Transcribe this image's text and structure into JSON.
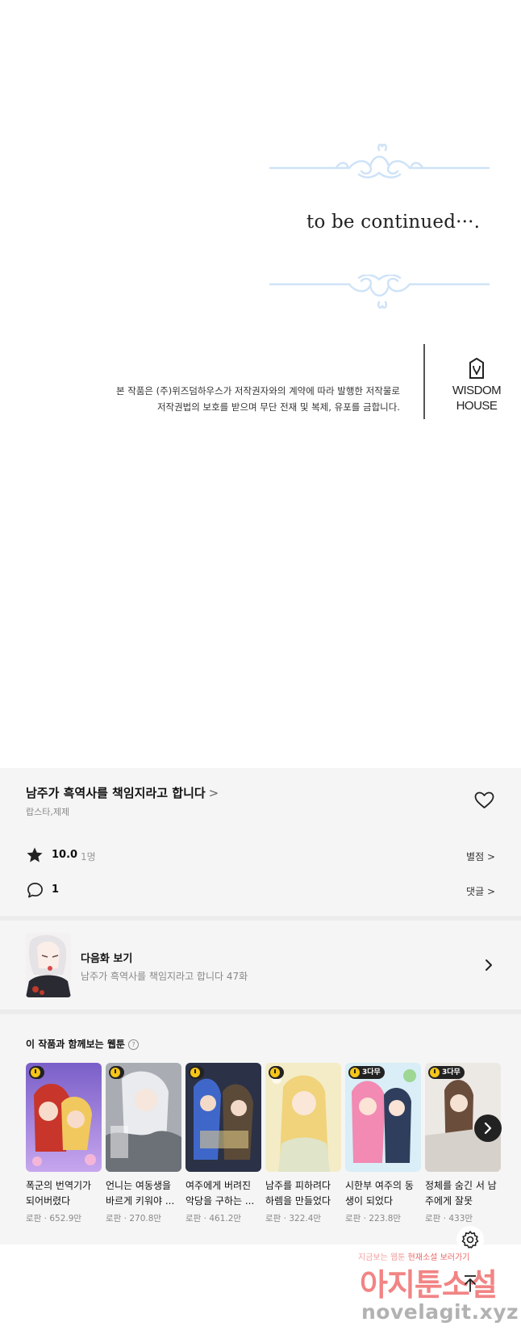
{
  "ending": {
    "tbc": "to be continued···.",
    "copyright_line1": "본 작품은 (주)위즈덤하우스가 저작권자와의 계약에 따라 발행한 저작물로",
    "copyright_line2": "저작권법의 보호를 받으며 무단 전재 및 복제, 유포를 금합니다.",
    "publisher_line1": "WISDOM",
    "publisher_line2": "HOUSE"
  },
  "series": {
    "title": "남주가 흑역사를 책임지라고 합니다",
    "title_chevron": ">",
    "authors": "랍스타,제제",
    "rating_score": "10.0",
    "rating_count": "1명",
    "rating_link": "별점 >",
    "comment_count": "1",
    "comment_link": "댓글 >"
  },
  "next_episode": {
    "label": "다음화 보기",
    "subtitle": "남주가 흑역사를 책임지라고 합니다 47화"
  },
  "recommend": {
    "heading": "이 작품과 함께보는 웹툰",
    "help": "?",
    "items": [
      {
        "title": "폭군의 번역기가 되어버렸다",
        "meta": "로판 · 652.9만",
        "badge": ""
      },
      {
        "title": "언니는 여동생을 바르게 키워야 ...",
        "meta": "로판 · 270.8만",
        "badge": ""
      },
      {
        "title": "여주에게 버려진 악당을 구하는 ...",
        "meta": "로판 · 461.2만",
        "badge": ""
      },
      {
        "title": "남주를 피하려다 하렘을 만들었다",
        "meta": "로판 · 322.4만",
        "badge": ""
      },
      {
        "title": "시한부 여주의 동생이 되었다",
        "meta": "로판 · 223.8만",
        "badge": "3다무"
      },
      {
        "title": "정체를 숨긴 서 남주에게 잘못",
        "meta": "로판 · 433만",
        "badge": "3다무"
      }
    ]
  },
  "watermark": {
    "line1_a": "지금보는 웹툰",
    "line1_b": "현재소설",
    "line1_c": "보러가기",
    "line2": "아지툰소설",
    "line3": "novelagit.xyz"
  },
  "icons": {
    "ornament": "scroll-ornament",
    "logo": "wisdom-house-logo-icon",
    "heart": "heart-icon",
    "star": "star-icon",
    "comment": "speech-bubble-icon",
    "chevron": "chevron-right-icon",
    "settings": "gear-icon",
    "top": "arrow-up-icon"
  },
  "colors": {
    "ornament": "#cfe3f7",
    "panel_bg": "#f5f5f5",
    "badge_clock": "#f5c518"
  }
}
